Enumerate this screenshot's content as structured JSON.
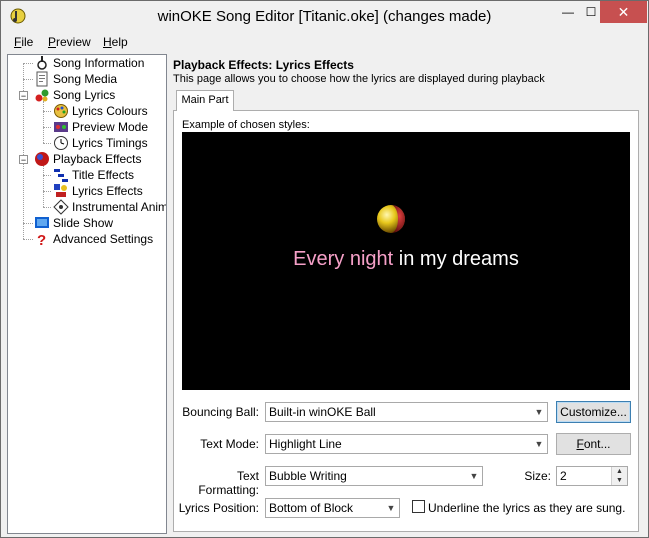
{
  "window": {
    "title": "winOKE Song Editor [Titanic.oke] (changes made)",
    "min_glyph": "—",
    "max_glyph": "☐",
    "close_glyph": "✕"
  },
  "menu": {
    "file": {
      "key": "F",
      "rest": "ile"
    },
    "preview": {
      "key": "P",
      "rest": "review"
    },
    "help": {
      "key": "H",
      "rest": "elp"
    }
  },
  "tree": {
    "items": [
      {
        "label": "Song Information",
        "icon": "song-information-icon"
      },
      {
        "label": "Song Media",
        "icon": "song-media-icon"
      },
      {
        "label": "Song Lyrics",
        "icon": "song-lyrics-icon"
      },
      {
        "label": "Lyrics Colours",
        "icon": "lyrics-colours-icon"
      },
      {
        "label": "Preview Mode",
        "icon": "preview-mode-icon"
      },
      {
        "label": "Lyrics Timings",
        "icon": "lyrics-timings-icon"
      },
      {
        "label": "Playback Effects",
        "icon": "playback-effects-icon"
      },
      {
        "label": "Title Effects",
        "icon": "title-effects-icon"
      },
      {
        "label": "Lyrics Effects",
        "icon": "lyrics-effects-icon"
      },
      {
        "label": "Instrumental Anim",
        "icon": "instrumental-anim-icon"
      },
      {
        "label": "Slide Show",
        "icon": "slide-show-icon"
      },
      {
        "label": "Advanced Settings",
        "icon": "advanced-settings-icon"
      }
    ],
    "expander_open": "−"
  },
  "page": {
    "heading": "Playback Effects: Lyrics Effects",
    "description": "This page allows you to choose how the lyrics are displayed during playback",
    "tab_main": "Main Part",
    "example_label": "Example of chosen styles:",
    "preview_sung": "Every night",
    "preview_unsung": " in my dreams"
  },
  "form": {
    "bouncing_ball_label": "Bouncing Ball:",
    "bouncing_ball_value": "Built-in winOKE Ball",
    "customize_button": "Customize...",
    "text_mode_label": "Text Mode:",
    "text_mode_value": "Highlight Line",
    "font_button_key": "F",
    "font_button_rest": "ont...",
    "text_formatting_label": "Text Formatting:",
    "text_formatting_value": "Bubble Writing",
    "size_label": "Size:",
    "size_value": "2",
    "lyrics_position_label": "Lyrics Position:",
    "lyrics_position_value": "Bottom of Block",
    "underline_label": "Underline the lyrics as they are sung.",
    "underline_checked": false
  },
  "colors": {
    "sung_lyric": "#f6a0c8",
    "unsung_lyric": "#ffffff",
    "preview_bg": "#000000",
    "close_button": "#c75050"
  }
}
